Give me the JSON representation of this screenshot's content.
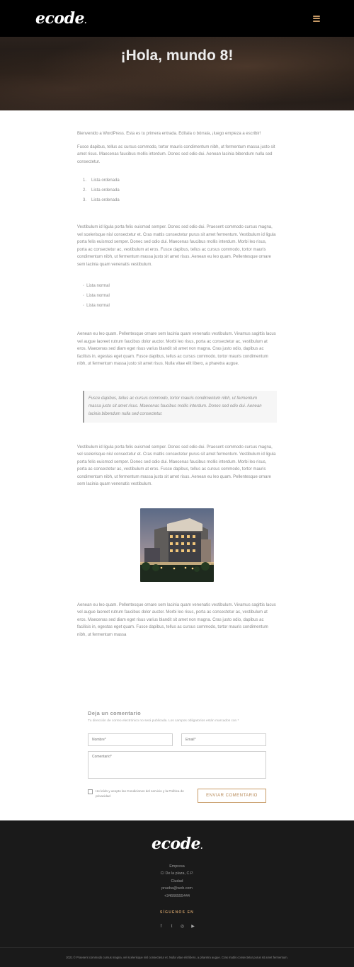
{
  "header": {
    "logo": "ecode",
    "accent": "#c79a66"
  },
  "hero": {
    "title": "¡Hola, mundo 8!"
  },
  "post": {
    "intro": "Bienvenido a WordPress. Esta es tu primera entrada. Edítala o bórrala, ¡luego empieza a escribir!",
    "p1": "Fusce dapibus, tellus ac cursus commodo, tortor mauris condimentum nibh, ut fermentum massa justo sit amet risus. Maecenas faucibus mollis interdum. Donec sed odio dui. Aenean lacinia bibendum nulla sed consectetur.",
    "ordered_list": [
      {
        "num": "1.",
        "text": "Lista ordenada"
      },
      {
        "num": "2.",
        "text": "Lista ordenada"
      },
      {
        "num": "3.",
        "text": "Lista ordenada"
      }
    ],
    "p2": "Vestibulum id ligula porta felis euismod semper. Donec sed odio dui. Praesent commodo cursus magna, vel scelerisque nisl consectetur et. Cras mattis consectetur purus sit amet fermentum. Vestibulum id ligula porta felis euismod semper. Donec sed odio dui. Maecenas faucibus mollis interdum. Morbi leo risus, porta ac consectetur ac, vestibulum at eros. Fusce dapibus, tellus ac cursus commodo, tortor mauris condimentum nibh, ut fermentum massa justo sit amet risus. Aenean eu leo quam. Pellentesque ornare sem lacinia quam venenatis vestibulum.",
    "unordered_list": [
      "Lista normal",
      "Lista normal",
      "Lista normal"
    ],
    "p3": "Aenean eu leo quam. Pellentesque ornare sem lacinia quam venenatis vestibulum. Vivamus sagittis lacus vel augue laoreet rutrum faucibus dolor auctor. Morbi leo risus, porta ac consectetur ac, vestibulum at eros. Maecenas sed diam eget risus varius blandit sit amet non magna. Cras justo odio, dapibus ac facilisis in, egestas eget quam. Fusce dapibus, tellus ac cursus commodo, tortor mauris condimentum nibh, ut fermentum massa justo sit amet risus. Nulla vitae elit libero, a pharetra augue.",
    "quote": "Fusce dapibus, tellus ac cursus commodo, tortor mauris condimentum nibh, ut fermentum massa justo sit amet risus. Maecenas faucibus mollis interdum. Donec sed odio dui. Aenean lacinia bibendum nulla sed consectetur.",
    "p4": "Vestibulum id ligula porta felis euismod semper. Donec sed odio dui. Praesent commodo cursus magna, vel scelerisque nisl consectetur et. Cras mattis consectetur purus sit amet fermentum. Vestibulum id ligula porta felis euismod semper. Donec sed odio dui. Maecenas faucibus mollis interdum. Morbi leo risus, porta ac consectetur ac, vestibulum at eros. Fusce dapibus, tellus ac cursus commodo, tortor mauris condimentum nibh, ut fermentum massa justo sit amet risus. Aenean eu leo quam. Pellentesque ornare sem lacinia quam venenatis vestibulum.",
    "p5": "Aenean eu leo quam. Pellentesque ornare sem lacinia quam venenatis vestibulum. Vivamus sagittis lacus vel augue laoreet rutrum faucibus dolor auctor. Morbi leo risus, porta ac consectetur ac, vestibulum at eros. Maecenas sed diam eget risus varius blandit sit amet non magna. Cras justo odio, dapibus ac facilisis in, egestas eget quam. Fusce dapibus, tellus ac cursus commodo, tortor mauris condimentum nibh, ut fermentum massa"
  },
  "comment_form": {
    "title": "Deja un comentario",
    "note": "Tu dirección de correo electrónico no será publicada. Los campos obligatorios están marcados con *",
    "name_placeholder": "Nombre*",
    "email_placeholder": "Email*",
    "comment_placeholder": "Comentario*",
    "consent_label": "He leído y acepto las Condiciones del servicio y la Política de privacidad",
    "submit_label": "ENVIAR COMENTARIO"
  },
  "footer": {
    "logo": "ecode",
    "company": "Empresa",
    "address": "C/ De la plaza, C.P.",
    "city": "Ciudad",
    "email": "prueba@web.com",
    "phone": "+34666555444",
    "follow_label": "SÍGUENOS EN",
    "socials": [
      {
        "icon": "facebook-icon",
        "glyph": "f"
      },
      {
        "icon": "twitter-icon",
        "glyph": "t"
      },
      {
        "icon": "instagram-icon",
        "glyph": "◎"
      },
      {
        "icon": "youtube-icon",
        "glyph": "▶"
      }
    ],
    "copyright": "2021 © Praesent commodo cursus magna, vel scelerisque nisl consectetur et. Nulla vitae elit libero, a pharetra augue. Cras mattis consectetur purus sit amet fermentum."
  }
}
